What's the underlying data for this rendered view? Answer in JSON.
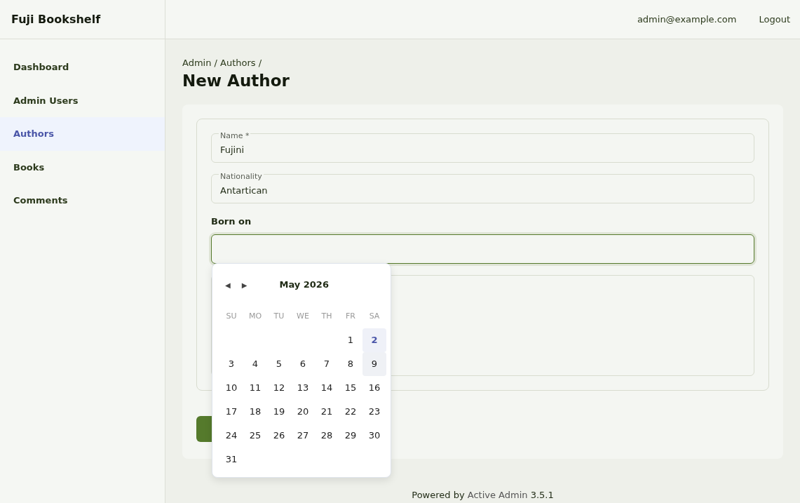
{
  "brand": "Fuji Bookshelf",
  "header_links": [
    {
      "label": "admin@example.com"
    },
    {
      "label": "Logout"
    }
  ],
  "sidebar": {
    "items": [
      {
        "label": "Dashboard",
        "selected": false
      },
      {
        "label": "Admin Users",
        "selected": false
      },
      {
        "label": "Authors",
        "selected": true
      },
      {
        "label": "Books",
        "selected": false
      },
      {
        "label": "Comments",
        "selected": false
      }
    ]
  },
  "breadcrumb": "Admin / Authors /",
  "page_title": "New Author",
  "form": {
    "fields": [
      {
        "kind": "floating",
        "label": "Name *",
        "value": "Fujini"
      },
      {
        "kind": "floating",
        "label": "Nationality",
        "value": "Antartican"
      },
      {
        "kind": "date",
        "label": "Born on",
        "focused": true
      },
      {
        "kind": "textarea"
      }
    ]
  },
  "datepicker": {
    "month": "May 2026",
    "prev": "◀",
    "next": "▶",
    "weekdays": [
      "SU",
      "MO",
      "TU",
      "WE",
      "TH",
      "FR",
      "SA"
    ],
    "weeks": [
      [
        {
          "day": "1",
          "today": false,
          "hovered": false
        },
        {
          "day": "2",
          "today": true,
          "hovered": false
        }
      ],
      [
        {
          "day": "3",
          "today": false,
          "hovered": false
        },
        {
          "day": "4",
          "today": false,
          "hovered": false
        },
        {
          "day": "5",
          "today": false,
          "hovered": false
        },
        {
          "day": "6",
          "today": false,
          "hovered": false
        },
        {
          "day": "7",
          "today": false,
          "hovered": false
        },
        {
          "day": "8",
          "today": false,
          "hovered": false
        },
        {
          "day": "9",
          "today": false,
          "hovered": true
        }
      ],
      [
        {
          "day": "10",
          "today": false,
          "hovered": false
        },
        {
          "day": "11",
          "today": false,
          "hovered": false
        },
        {
          "day": "12",
          "today": false,
          "hovered": false
        },
        {
          "day": "13",
          "today": false,
          "hovered": false
        },
        {
          "day": "14",
          "today": false,
          "hovered": false
        },
        {
          "day": "15",
          "today": false,
          "hovered": false
        },
        {
          "day": "16",
          "today": false,
          "hovered": false
        }
      ],
      [
        {
          "day": "17",
          "today": false,
          "hovered": false
        },
        {
          "day": "18",
          "today": false,
          "hovered": false
        },
        {
          "day": "19",
          "today": false,
          "hovered": false
        },
        {
          "day": "20",
          "today": false,
          "hovered": false
        },
        {
          "day": "21",
          "today": false,
          "hovered": false
        },
        {
          "day": "22",
          "today": false,
          "hovered": false
        },
        {
          "day": "23",
          "today": false,
          "hovered": false
        }
      ],
      [
        {
          "day": "24",
          "today": false,
          "hovered": false
        },
        {
          "day": "25",
          "today": false,
          "hovered": false
        },
        {
          "day": "26",
          "today": false,
          "hovered": false
        },
        {
          "day": "27",
          "today": false,
          "hovered": false
        },
        {
          "day": "28",
          "today": false,
          "hovered": false
        },
        {
          "day": "29",
          "today": false,
          "hovered": false
        },
        {
          "day": "30",
          "today": false,
          "hovered": false
        }
      ],
      [
        {
          "day": "31",
          "today": false,
          "hovered": false
        }
      ]
    ]
  },
  "footer": {
    "prefix": "Powered by",
    "link": "Active Admin",
    "version": "3.5.1"
  }
}
